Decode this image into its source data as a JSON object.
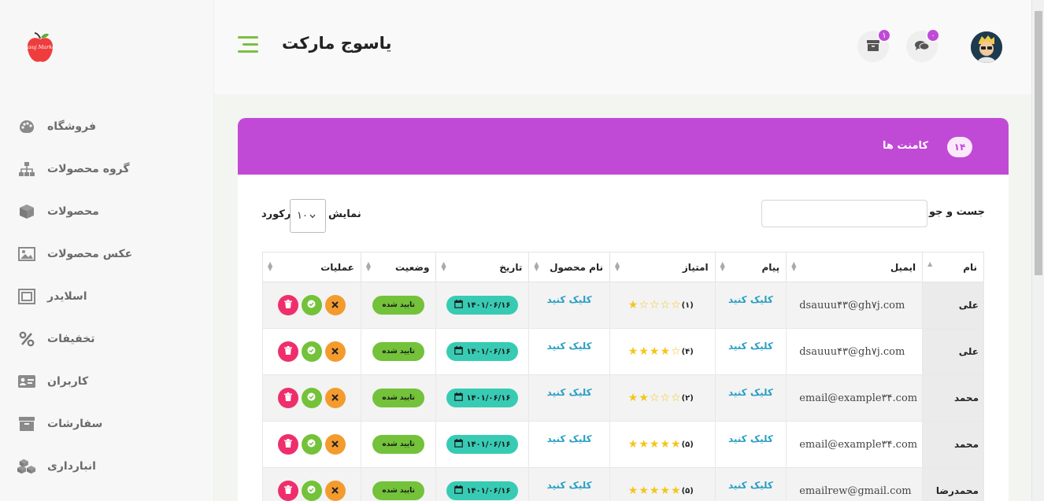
{
  "brand": {
    "title": "یاسوج مارکت",
    "logo_text": "Yasuj Market"
  },
  "header": {
    "archive_badge": "۱",
    "chat_badge": "۰"
  },
  "sidebar": {
    "items": [
      {
        "label": "فروشگاه",
        "icon": "palette-icon"
      },
      {
        "label": "گروه محصولات",
        "icon": "sitemap-icon"
      },
      {
        "label": "محصولات",
        "icon": "cube-icon"
      },
      {
        "label": "عکس محصولات",
        "icon": "image-icon"
      },
      {
        "label": "اسلایدر",
        "icon": "slider-icon"
      },
      {
        "label": "تخفیفات",
        "icon": "percent-icon"
      },
      {
        "label": "کاربران",
        "icon": "id-card-icon"
      },
      {
        "label": "سفارشات",
        "icon": "archive-icon"
      },
      {
        "label": "انبارداری",
        "icon": "cubes-icon"
      }
    ]
  },
  "card": {
    "title": "کامنت ها",
    "count": "۱۴"
  },
  "controls": {
    "search_label": "جست و جو :",
    "search_value": "",
    "show_label": "نمایش",
    "show_value": "۱۰",
    "records_label": "رکورد"
  },
  "table": {
    "headers": [
      "نام",
      "ایمیل",
      "پیام",
      "امتیاز",
      "نام محصول",
      "تاریخ",
      "وضعیت",
      "عملیات"
    ],
    "rows": [
      {
        "name": "علی",
        "email": "dsauuu۴۳@gh۷j.com",
        "message": "کلیک کنید",
        "rating": 1,
        "rating_label": "(۱)",
        "product": "کلیک کنید",
        "date": "۱۴۰۱/۰۶/۱۶",
        "status": "تایید شده"
      },
      {
        "name": "علی",
        "email": "dsauuu۴۳@gh۷j.com",
        "message": "کلیک کنید",
        "rating": 4,
        "rating_label": "(۴)",
        "product": "کلیک کنید",
        "date": "۱۴۰۱/۰۶/۱۶",
        "status": "تایید شده"
      },
      {
        "name": "محمد",
        "email": "email@example۳۴.com",
        "message": "کلیک کنید",
        "rating": 2,
        "rating_label": "(۲)",
        "product": "کلیک کنید",
        "date": "۱۴۰۱/۰۶/۱۶",
        "status": "تایید شده"
      },
      {
        "name": "محمد",
        "email": "email@example۳۴.com",
        "message": "کلیک کنید",
        "rating": 5,
        "rating_label": "(۵)",
        "product": "کلیک کنید",
        "date": "۱۴۰۱/۰۶/۱۶",
        "status": "تایید شده"
      },
      {
        "name": "محمدرضا",
        "email": "emailrew@gmail.com",
        "message": "کلیک کنید",
        "rating": 5,
        "rating_label": "(۵)",
        "product": "کلیک کنید",
        "date": "۱۴۰۱/۰۶/۱۶",
        "status": "تایید شده"
      }
    ]
  },
  "colors": {
    "accent": "#c04ad6",
    "green": "#73c23a",
    "teal": "#38cbb4",
    "star": "#f5c518",
    "delete": "#ee2f6c",
    "reject": "#f49b2e",
    "link": "#2a9fc5"
  }
}
